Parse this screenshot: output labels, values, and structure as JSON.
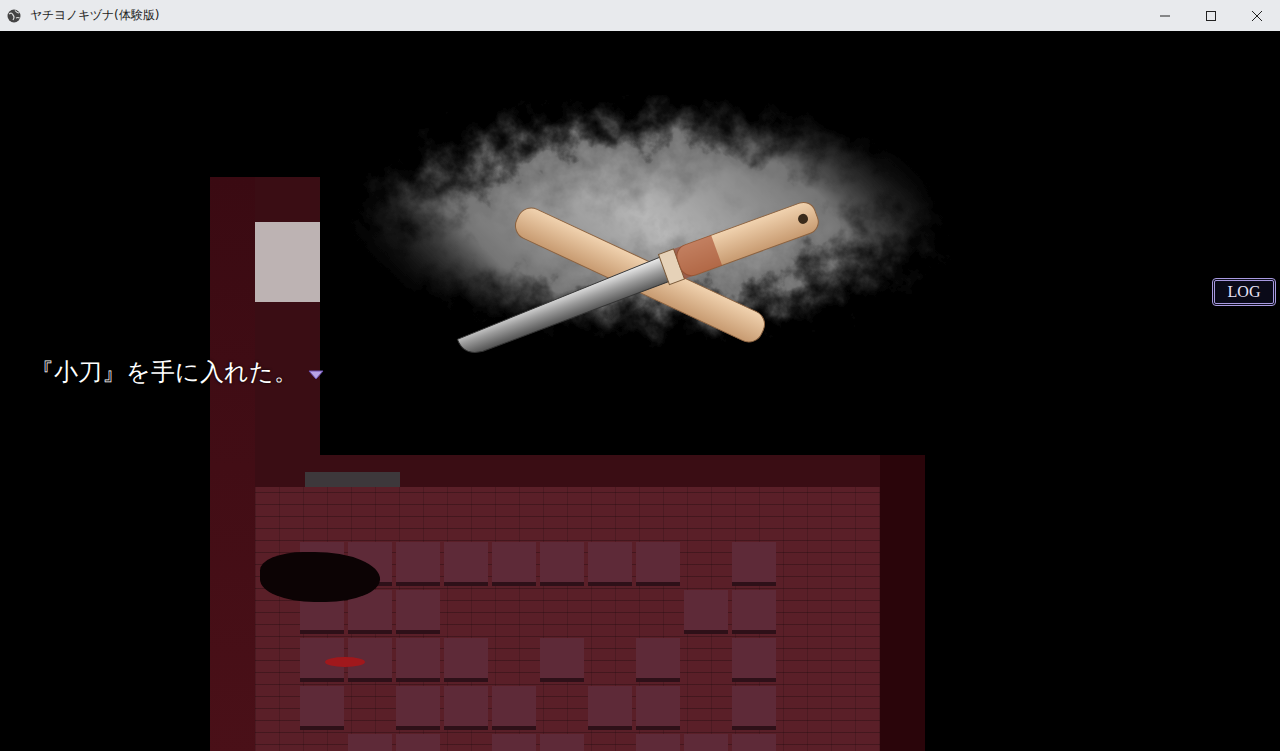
{
  "window": {
    "title": "ヤチヨノキヅナ(体験版)"
  },
  "item_popup": {
    "message": "『小刀』を手に入れた。"
  },
  "log_button": {
    "label": "LOG"
  }
}
